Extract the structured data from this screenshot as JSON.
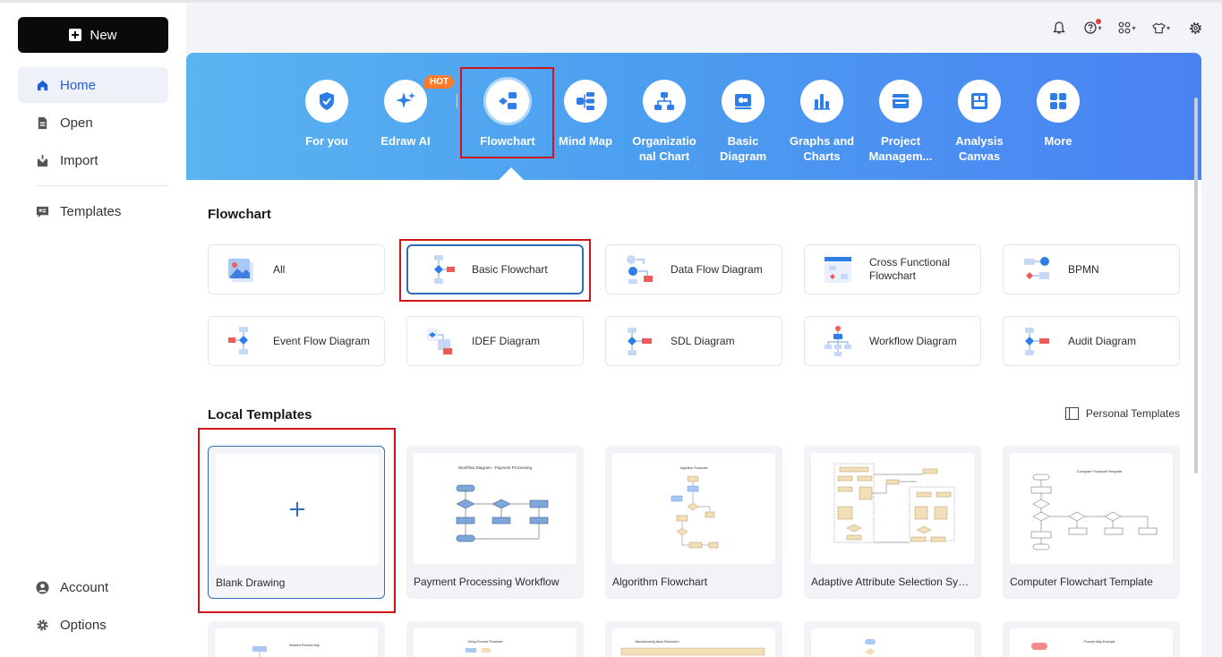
{
  "sidebar": {
    "new_label": "New",
    "items": [
      {
        "label": "Home"
      },
      {
        "label": "Open"
      },
      {
        "label": "Import"
      },
      {
        "label": "Templates"
      }
    ],
    "bottom": [
      {
        "label": "Account"
      },
      {
        "label": "Options"
      }
    ]
  },
  "topbar": {
    "icons": [
      "bell-icon",
      "help-icon",
      "apps-icon",
      "theme-icon",
      "settings-icon"
    ]
  },
  "categories": [
    {
      "label": "For you"
    },
    {
      "label": "Edraw AI"
    },
    {
      "label": "Flowchart"
    },
    {
      "label": "Mind Map"
    },
    {
      "label": "Organizatio nal Chart"
    },
    {
      "label": "Basic Diagram"
    },
    {
      "label": "Graphs and Charts"
    },
    {
      "label": "Project Managem..."
    },
    {
      "label": "Analysis Canvas"
    },
    {
      "label": "More"
    }
  ],
  "hot_badge": "HOT",
  "flowchart": {
    "title": "Flowchart",
    "types": [
      {
        "label": "All"
      },
      {
        "label": "Basic Flowchart"
      },
      {
        "label": "Data Flow Diagram"
      },
      {
        "label": "Cross Functional Flowchart"
      },
      {
        "label": "BPMN"
      },
      {
        "label": "Event Flow Diagram"
      },
      {
        "label": "IDEF Diagram"
      },
      {
        "label": "SDL Diagram"
      },
      {
        "label": "Workflow Diagram"
      },
      {
        "label": "Audit Diagram"
      }
    ]
  },
  "local": {
    "title": "Local Templates",
    "personal_label": "Personal Templates",
    "templates": [
      {
        "label": "Blank Drawing"
      },
      {
        "label": "Payment Processing Workflow",
        "thumb_title": "Workflow Diagram - Payment Processing"
      },
      {
        "label": "Algorithm Flowchart",
        "thumb_title": "Algorithm Flowchart"
      },
      {
        "label": "Adaptive Attribute Selection Syst..."
      },
      {
        "label": "Computer Flowchart Template",
        "thumb_title": "Computer Flowchart Template"
      }
    ],
    "partial_thumb_titles": [
      "Detailed Process Map",
      "Hiring Process Flowchart",
      "Manufacturing Issue Resolution",
      "",
      "Process Map Example"
    ]
  },
  "colors": {
    "accent": "#1f5fd6",
    "banner_start": "#5ab4f0",
    "banner_end": "#4a82f3",
    "highlight": "#d0141c",
    "hot": "#ff7a2b"
  }
}
